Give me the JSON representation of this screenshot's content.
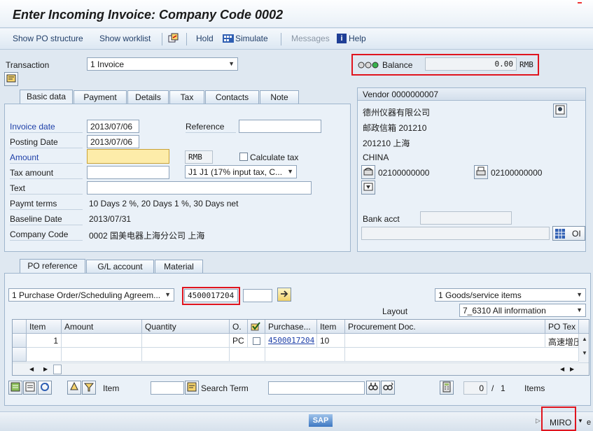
{
  "window": {
    "title": "Enter Incoming Invoice: Company Code 0002"
  },
  "toolbar": {
    "show_po_structure": "Show PO structure",
    "show_worklist": "Show worklist",
    "hold": "Hold",
    "simulate": "Simulate",
    "messages": "Messages",
    "help": "Help"
  },
  "transaction": {
    "label": "Transaction",
    "value": "1 Invoice"
  },
  "balance": {
    "label": "Balance",
    "value": "0.00",
    "currency": "RMB"
  },
  "header_tabs": [
    "Basic data",
    "Payment",
    "Details",
    "Tax",
    "Contacts",
    "Note"
  ],
  "basic": {
    "invoice_date_label": "Invoice date",
    "invoice_date": "2013/07/06",
    "posting_date_label": "Posting Date",
    "posting_date": "2013/07/06",
    "reference_label": "Reference",
    "reference": "",
    "amount_label": "Amount",
    "amount": "",
    "currency": "RMB",
    "calculate_tax_label": "Calculate tax",
    "tax_amount_label": "Tax amount",
    "tax_amount": "",
    "tax_code": "J1 J1 (17% input tax, C...",
    "text_label": "Text",
    "text": "",
    "paymt_terms_label": "Paymt terms",
    "paymt_terms": "10 Days 2 %, 20 Days 1 %, 30 Days net",
    "baseline_date_label": "Baseline Date",
    "baseline_date": "2013/07/31",
    "company_code_label": "Company Code",
    "company_code": "0002 国美电器上海分公司 上海"
  },
  "vendor": {
    "title": "Vendor 0000000007",
    "name": "德州仪器有限公司",
    "line1": "邮政信箱 201210",
    "line2": "201210 上海",
    "country": "CHINA",
    "phone": "02100000000",
    "fax": "02100000000",
    "bank_acct_label": "Bank acct",
    "bank_acct": "",
    "oi_label": "OI"
  },
  "lower_tabs": [
    "PO reference",
    "G/L account",
    "Material"
  ],
  "po_ref": {
    "doc_type": "1 Purchase Order/Scheduling Agreem...",
    "po_number": "4500017204",
    "item_value": "",
    "goods_type": "1 Goods/service items",
    "layout_label": "Layout",
    "layout": "7_6310 All information"
  },
  "grid": {
    "columns": [
      "Item",
      "Amount",
      "Quantity",
      "O.",
      "",
      "Purchase...",
      "Item",
      "Procurement Doc.",
      "PO Tex"
    ],
    "rows": [
      {
        "item": "1",
        "amount": "",
        "quantity": "",
        "unit": "PC",
        "po": "4500017204",
        "po_item": "10",
        "proc_doc": "",
        "po_text": "高速增压"
      }
    ]
  },
  "bottom": {
    "item_label": "Item",
    "item_value": "",
    "search_term_label": "Search Term",
    "search_term": "",
    "counter_value": "0",
    "counter_sep": "/",
    "counter_total": "1",
    "items_label": "Items"
  },
  "status": {
    "sap_logo": "SAP",
    "tcode": "MIRO"
  }
}
